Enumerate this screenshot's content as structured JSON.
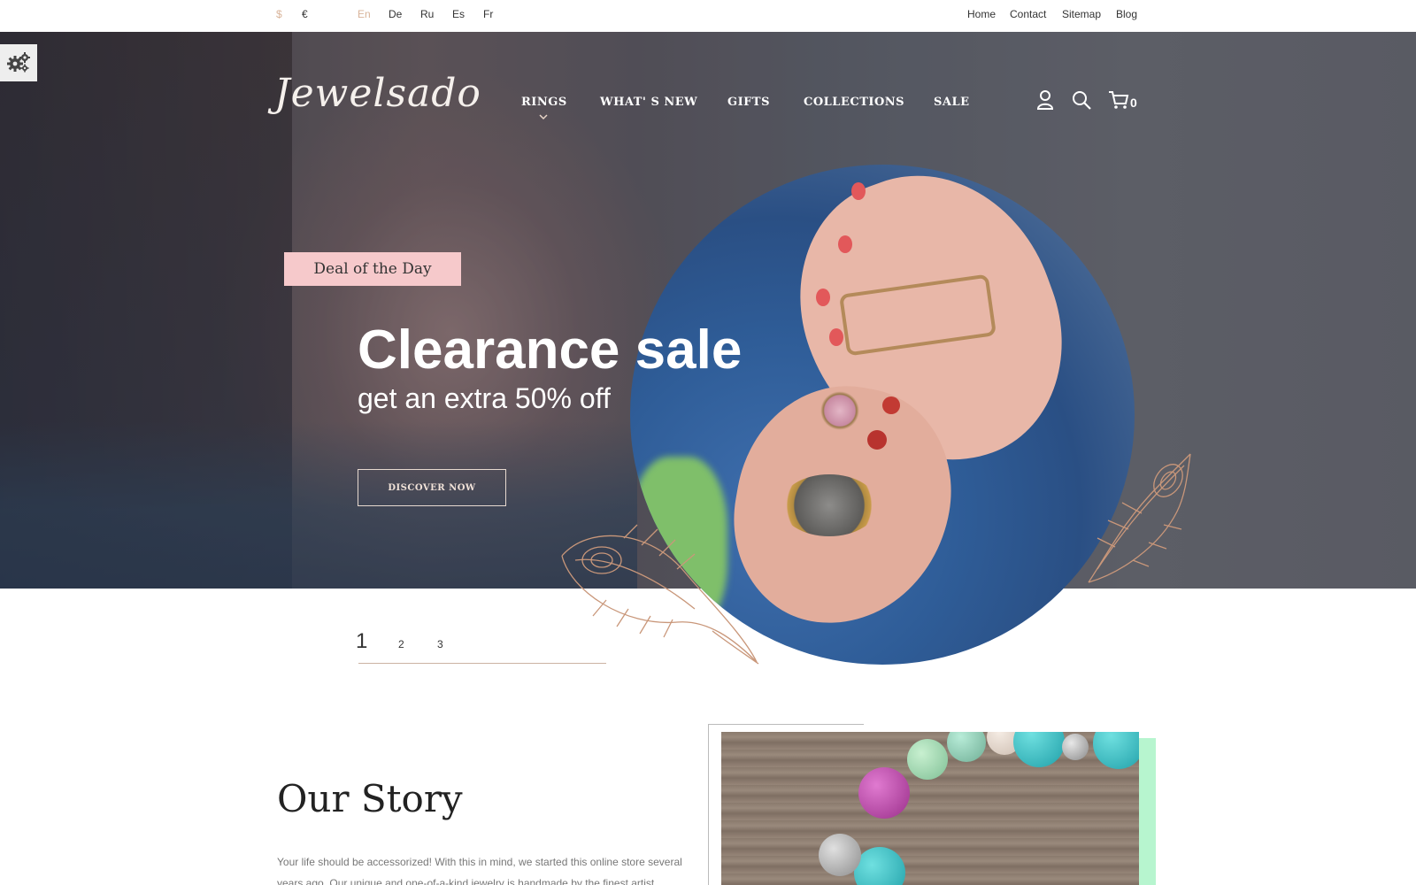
{
  "topbar": {
    "currencies": [
      "$",
      "€"
    ],
    "languages": [
      "En",
      "De",
      "Ru",
      "Es",
      "Fr"
    ],
    "active_language": "En",
    "links": [
      "Home",
      "Contact",
      "Sitemap",
      "Blog"
    ]
  },
  "header": {
    "logo": "Jewelsado",
    "nav": [
      "RINGS",
      "WHAT' S NEW",
      "GIFTS",
      "COLLECTIONS",
      "SALE"
    ],
    "cart_count": "0"
  },
  "hero": {
    "badge": "Deal of the Day",
    "title": "Clearance sale",
    "subtitle": "get an extra 50% off",
    "cta": "DISCOVER NOW"
  },
  "pager": {
    "pages": [
      "1",
      "2",
      "3"
    ],
    "active": "1"
  },
  "story": {
    "title": "Our Story",
    "text": "Your life should be accessorized! With this in mind, we started this online store several years ago. Our unique and one-of-a-kind jewelry is handmade by the finest artist jewelers"
  },
  "colors": {
    "accent": "#d9b49a",
    "badge_bg": "#f6c9cb",
    "mint": "#b7f5cf"
  },
  "icons": [
    "gear-icon",
    "user-icon",
    "search-icon",
    "cart-icon",
    "chevron-down-icon",
    "feather-icon"
  ]
}
